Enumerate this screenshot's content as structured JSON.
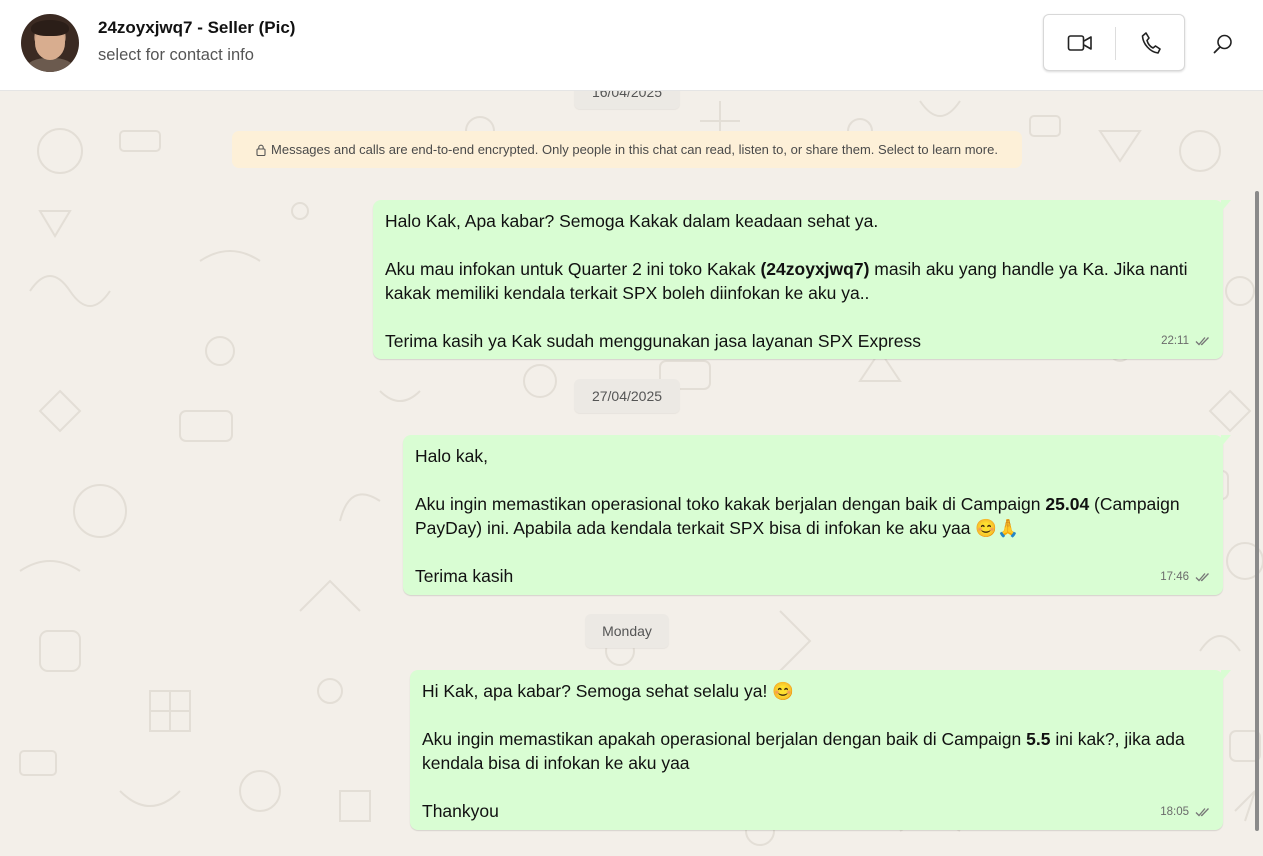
{
  "header": {
    "contact_name": "24zoyxjwq7 - Seller (Pic)",
    "contact_subtitle": "select for contact info",
    "icons": [
      "video-call-icon",
      "voice-call-icon",
      "search-icon"
    ]
  },
  "chat": {
    "top_date": "16/04/2025",
    "encryption_notice": "Messages and calls are end-to-end encrypted. Only people in this chat can read, listen to, or share them. Select to learn more.",
    "messages": [
      {
        "lines": {
          "l1": "Halo Kak, Apa kabar? Semoga Kakak dalam keadaan sehat ya.",
          "l2a": "Aku mau infokan untuk Quarter 2 ini toko Kakak ",
          "l2b": "(24zoyxjwq7)",
          "l2c": " masih aku yang handle ya Ka. Jika nanti",
          "l3": "kakak memiliki kendala terkait SPX boleh diinfokan ke aku ya..",
          "l4": "Terima kasih ya Kak sudah menggunakan jasa layanan SPX Express"
        },
        "time": "22:11"
      },
      {
        "date": "27/04/2025",
        "lines": {
          "l1": "Halo kak,",
          "l2a": "Aku ingin memastikan operasional toko kakak berjalan dengan baik di Campaign ",
          "l2b": "25.04",
          "l2c": " (Campaign",
          "l3": "PayDay) ini. Apabila ada kendala terkait SPX bisa di infokan ke aku yaa 😊🙏",
          "l4": "Terima kasih"
        },
        "time": "17:46"
      },
      {
        "date": "Monday",
        "lines": {
          "l1": "Hi Kak, apa kabar? Semoga sehat selalu ya! 😊",
          "l2a": "Aku ingin memastikan apakah operasional berjalan dengan baik di Campaign ",
          "l2b": "5.5",
          "l2c": " ini kak?, jika ada",
          "l3": "kendala bisa di infokan ke aku yaa",
          "l4": "Thankyou"
        },
        "time": "18:05"
      }
    ]
  },
  "colors": {
    "outgoing_bubble": "#d9fdd3",
    "chat_background": "#f3efe9",
    "encryption_bg": "#fdf0d8"
  }
}
